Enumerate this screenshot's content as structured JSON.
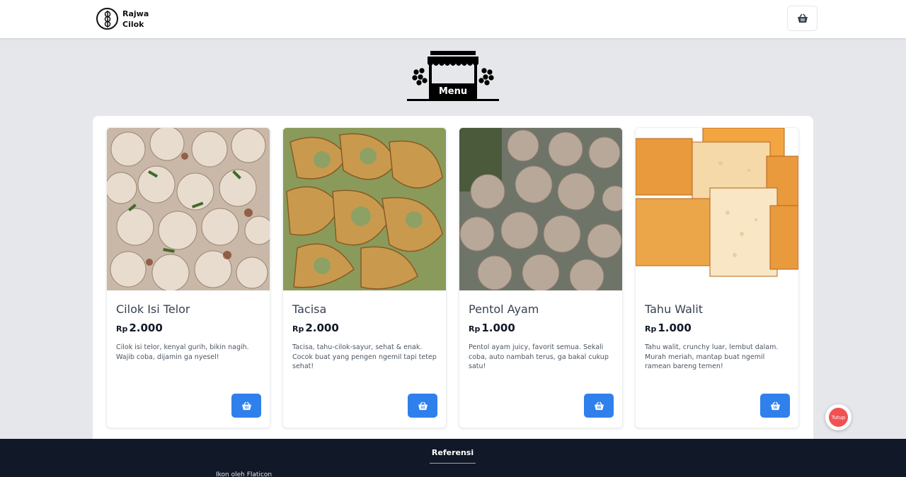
{
  "header": {
    "brand_line1": "Rajwa",
    "brand_line2": "Cilok",
    "logo_icon": "cilok-skewer-icon",
    "cart_icon": "basket-icon"
  },
  "hero": {
    "label": "Menu",
    "icon": "food-stall-icon"
  },
  "products": [
    {
      "name": "Cilok Isi Telor",
      "currency": "Rp",
      "price": "2.000",
      "description": "Cilok isi telor, kenyal gurih, bikin nagih. Wajib coba, dijamin ga nyesel!",
      "image": "cilok-photo"
    },
    {
      "name": "Tacisa",
      "currency": "Rp",
      "price": "2.000",
      "description": "Tacisa, tahu-cilok-sayur, sehat & enak. Cocok buat yang pengen ngemil tapi tetep sehat!",
      "image": "tacisa-photo"
    },
    {
      "name": "Pentol Ayam",
      "currency": "Rp",
      "price": "1.000",
      "description": "Pentol ayam juicy, favorit semua. Sekali coba, auto nambah terus, ga bakal cukup satu!",
      "image": "meatball-photo"
    },
    {
      "name": "Tahu Walit",
      "currency": "Rp",
      "price": "1.000",
      "description": "Tahu walit, crunchy luar, lembut dalam. Murah meriah, mantap buat ngemil ramean bareng temen!",
      "image": "fried-tofu-photo"
    }
  ],
  "floating": {
    "close_label": "Tutup"
  },
  "footer": {
    "title": "Referensi",
    "credit": "Ikon oleh Flaticon"
  },
  "colors": {
    "accent": "#2f80ed",
    "background": "#e5e7eb",
    "footer": "#111827",
    "close": "#f05252"
  }
}
